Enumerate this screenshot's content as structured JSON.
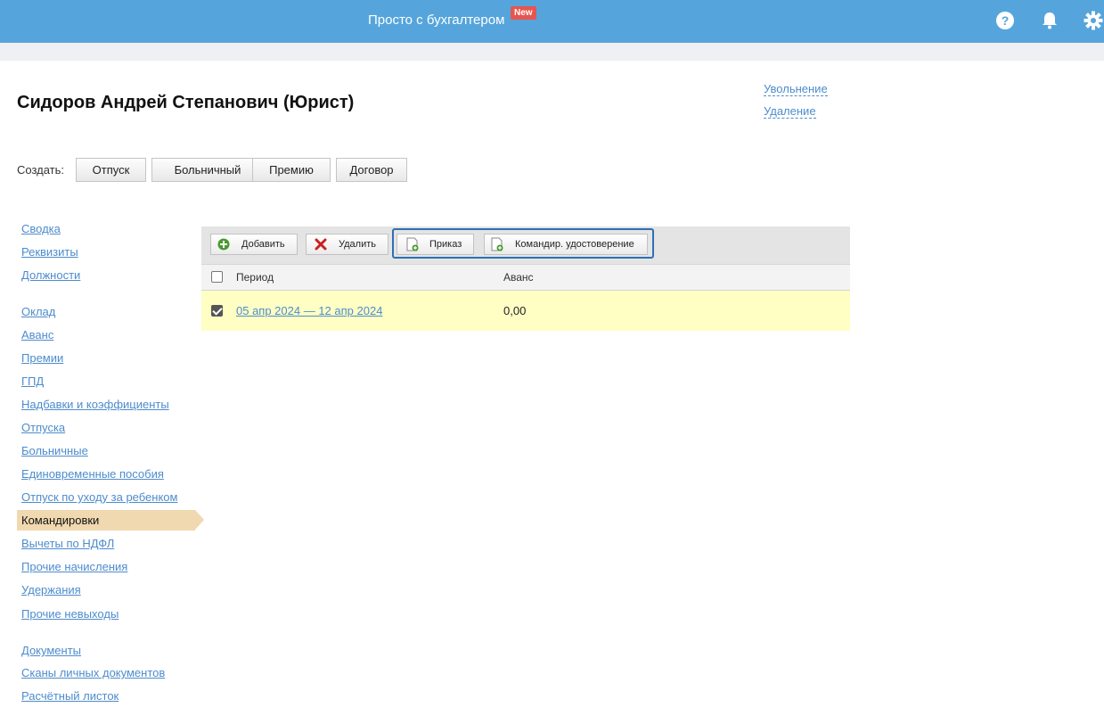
{
  "header": {
    "title": "Просто с бухгалтером",
    "badge": "New",
    "icons": [
      "help-icon",
      "bell-icon",
      "gear-icon"
    ]
  },
  "employee": {
    "name": "Сидоров Андрей Степанович (Юрист)"
  },
  "side_actions": [
    "Увольнение",
    "Удаление"
  ],
  "create": {
    "label": "Создать:",
    "buttons": [
      "Отпуск",
      "Больничный",
      "Премию",
      "Договор"
    ]
  },
  "nav": {
    "group1": [
      "Сводка",
      "Реквизиты",
      "Должности"
    ],
    "group2": [
      "Оклад",
      "Аванс",
      "Премии",
      "ГПД",
      "Надбавки и коэффициенты",
      "Отпуска",
      "Больничные",
      "Единовременные пособия",
      "Отпуск по уходу за ребенком",
      "Командировки",
      "Вычеты по НДФЛ",
      "Прочие начисления",
      "Удержания",
      "Прочие невыходы"
    ],
    "group3": [
      "Документы",
      "Сканы личных документов",
      "Расчётный листок"
    ],
    "active": "Командировки"
  },
  "toolbar": {
    "add": "Добавить",
    "delete": "Удалить",
    "order": "Приказ",
    "certificate": "Командир. удостоверение"
  },
  "table": {
    "columns": [
      "Период",
      "Аванс"
    ],
    "rows": [
      {
        "period": "05 апр 2024 — 12 апр 2024",
        "avans": "0,00",
        "checked": true
      }
    ]
  },
  "colors": {
    "header_bg": "#55a5dc",
    "link": "#4d8ccc",
    "active_nav": "#f0d8b0",
    "selected_row": "#ffffc4",
    "highlight_border": "#2f6fb4"
  }
}
